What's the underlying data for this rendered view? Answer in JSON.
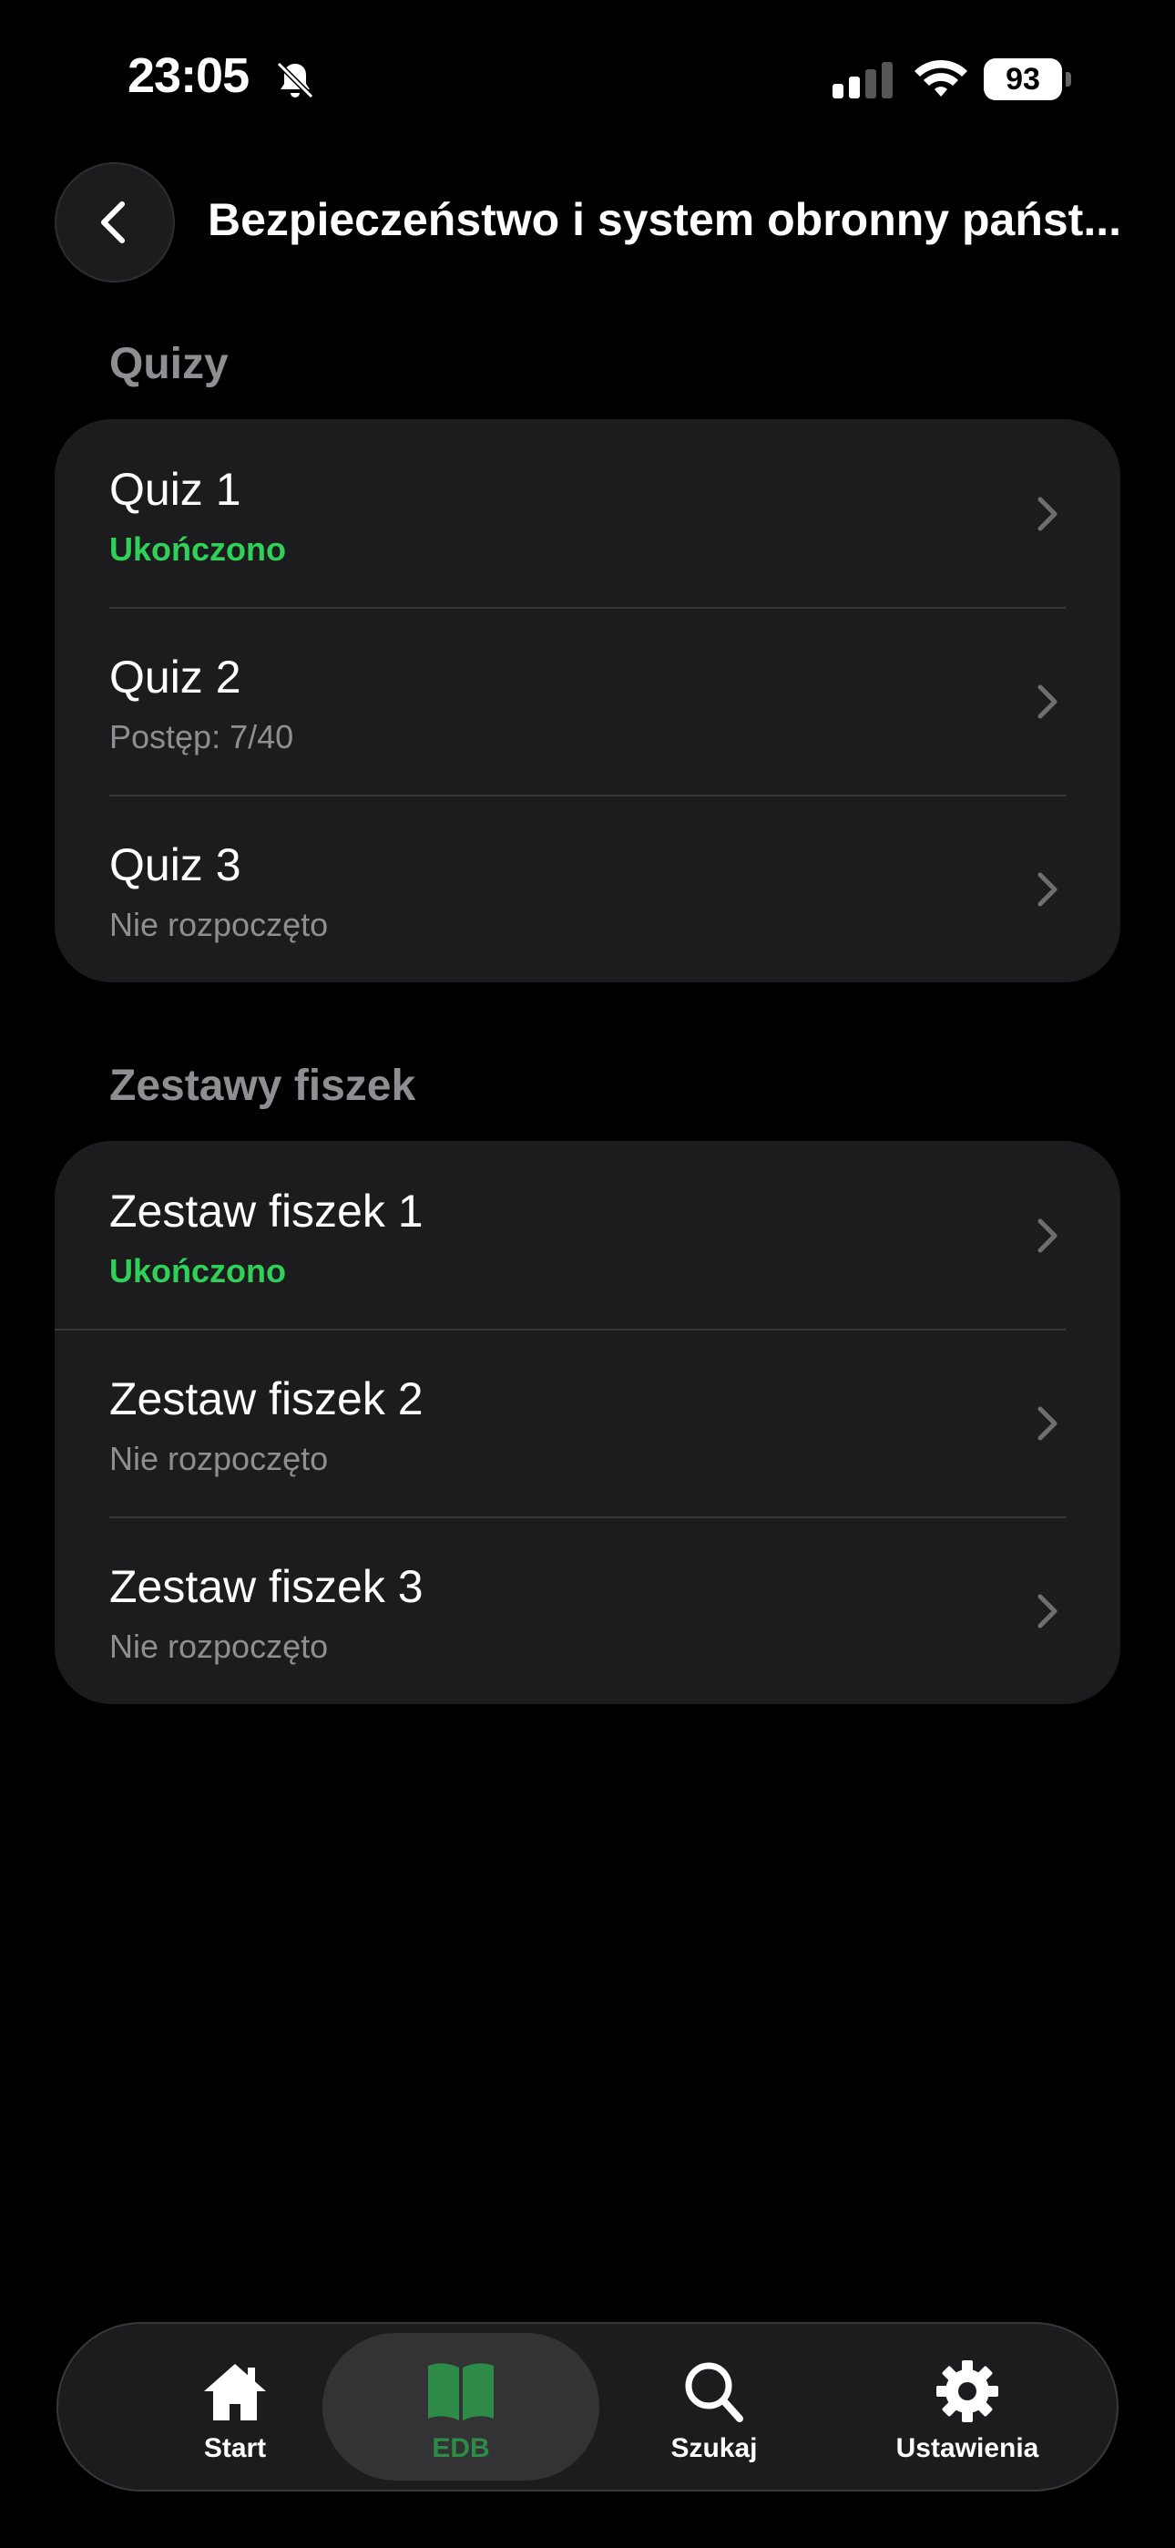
{
  "status_bar": {
    "time": "23:05",
    "battery": "93"
  },
  "header": {
    "title": "Bezpieczeństwo i system obronny państ..."
  },
  "sections": [
    {
      "title": "Quizy",
      "items": [
        {
          "title": "Quiz 1",
          "subtitle": "Ukończono",
          "status": "done"
        },
        {
          "title": "Quiz 2",
          "subtitle": "Postęp: 7/40",
          "status": "progress"
        },
        {
          "title": "Quiz 3",
          "subtitle": "Nie rozpoczęto",
          "status": "not-started"
        }
      ]
    },
    {
      "title": "Zestawy fiszek",
      "items": [
        {
          "title": "Zestaw fiszek 1",
          "subtitle": "Ukończono",
          "status": "done"
        },
        {
          "title": "Zestaw fiszek 2",
          "subtitle": "Nie rozpoczęto",
          "status": "not-started"
        },
        {
          "title": "Zestaw fiszek 3",
          "subtitle": "Nie rozpoczęto",
          "status": "not-started"
        }
      ]
    }
  ],
  "tab_bar": {
    "tabs": [
      {
        "label": "Start",
        "icon": "home-icon"
      },
      {
        "label": "EDB",
        "icon": "book-icon",
        "active": true
      },
      {
        "label": "Szukaj",
        "icon": "search-icon"
      },
      {
        "label": "Ustawienia",
        "icon": "gear-icon"
      }
    ]
  },
  "colors": {
    "background": "#000000",
    "card": "#1c1c1e",
    "done": "#30d158",
    "secondary_text": "#8e8e93",
    "active_tab": "#2e8b47"
  }
}
